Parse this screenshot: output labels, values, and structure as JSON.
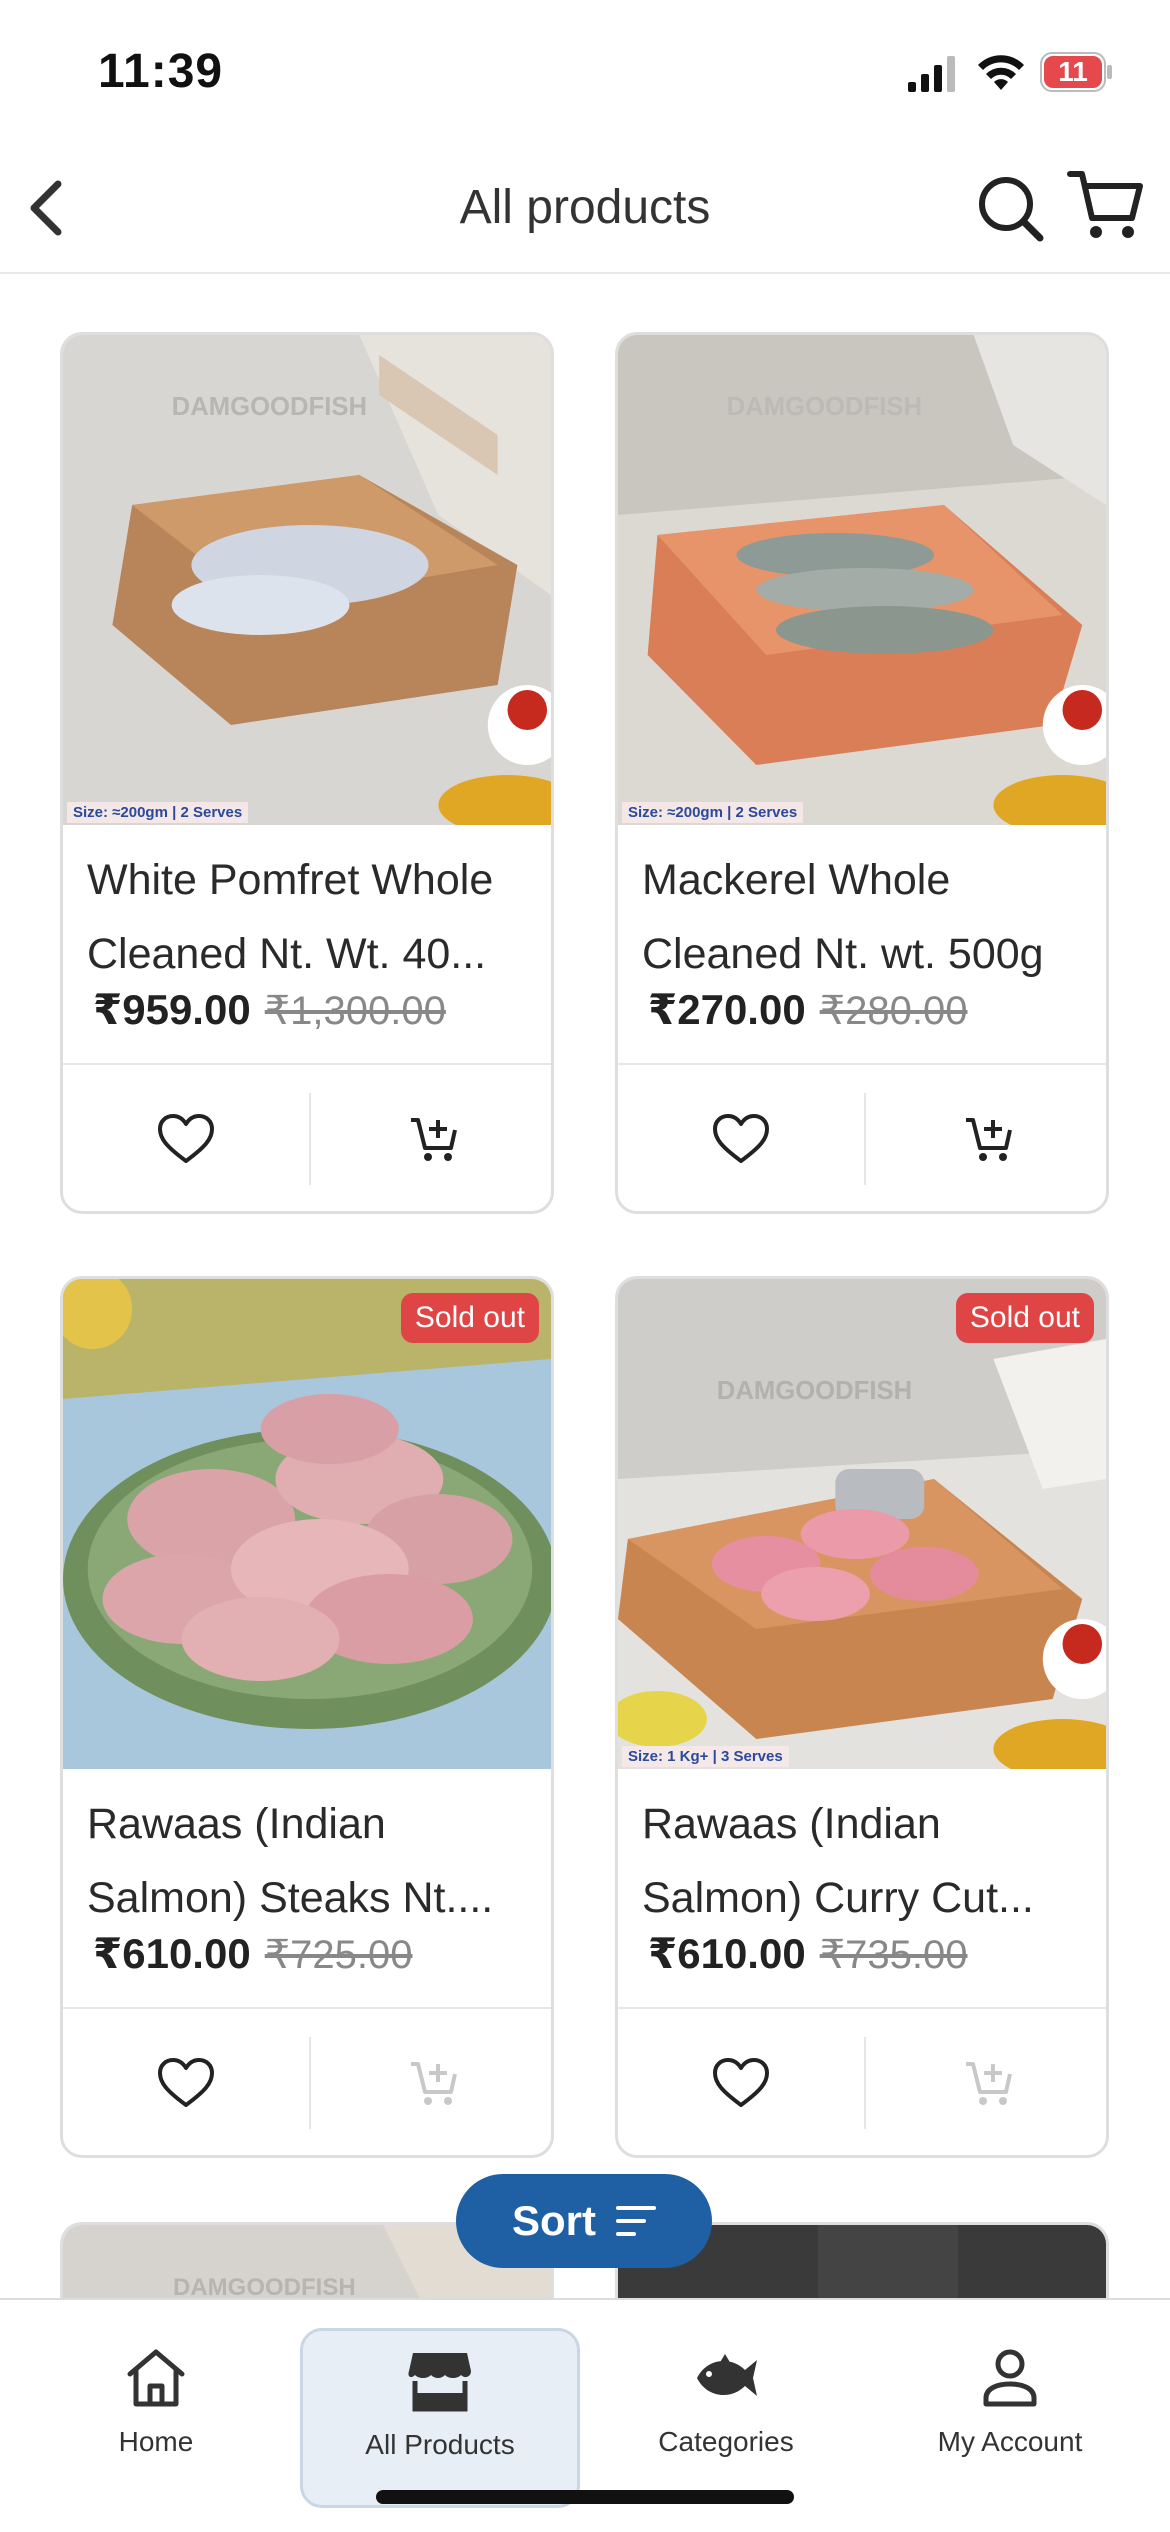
{
  "status_bar": {
    "time": "11:39",
    "battery": "11"
  },
  "header": {
    "title": "All products"
  },
  "products": [
    {
      "name_line1": "White Pomfret Whole",
      "name_line2": "Cleaned Nt. Wt. 40...",
      "price": "₹959.00",
      "old_price": "₹1,300.00",
      "size_tag": "Size: ≈200gm | 2 Serves",
      "sold_out": ""
    },
    {
      "name_line1": "Mackerel Whole",
      "name_line2": "Cleaned Nt. wt. 500g",
      "price": "₹270.00",
      "old_price": "₹280.00",
      "size_tag": "Size: ≈200gm | 2 Serves",
      "sold_out": ""
    },
    {
      "name_line1": "Rawaas (Indian",
      "name_line2": "Salmon)  Steaks Nt....",
      "price": "₹610.00",
      "old_price": "₹725.00",
      "size_tag": "",
      "sold_out": "Sold out"
    },
    {
      "name_line1": "Rawaas (Indian",
      "name_line2": "Salmon) Curry Cut...",
      "price": "₹610.00",
      "old_price": "₹735.00",
      "size_tag": "Size: 1 Kg+ | 3 Serves",
      "sold_out": "Sold out"
    }
  ],
  "sort": {
    "label": "Sort"
  },
  "bottom_nav": {
    "items": [
      {
        "label": "Home"
      },
      {
        "label": "All Products"
      },
      {
        "label": "Categories"
      },
      {
        "label": "My Account"
      }
    ],
    "active": "All Products"
  },
  "colors": {
    "accent": "#1f5fa3",
    "sold_out": "#e04545",
    "battery": "#e5484d"
  }
}
